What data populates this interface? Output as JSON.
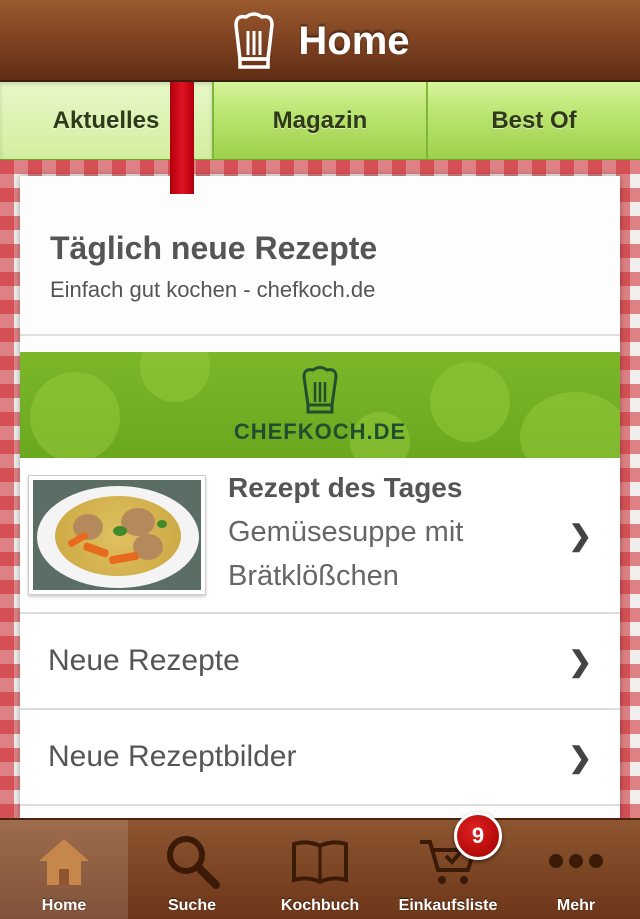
{
  "header": {
    "title": "Home"
  },
  "tabs": [
    {
      "label": "Aktuelles",
      "active": true
    },
    {
      "label": "Magazin",
      "active": false
    },
    {
      "label": "Best Of",
      "active": false
    }
  ],
  "intro": {
    "title": "Täglich neue Rezepte",
    "subtitle": "Einfach gut kochen - chefkoch.de"
  },
  "banner": {
    "logo_text": "CHEFKOCH.DE"
  },
  "featured": {
    "title": "Rezept des Tages",
    "line1": "Gemüsesuppe mit",
    "line2": "Brätklößchen"
  },
  "list": [
    {
      "label": "Neue Rezepte"
    },
    {
      "label": "Neue Rezeptbilder"
    }
  ],
  "tabbar": {
    "items": [
      {
        "label": "Home",
        "icon": "home-icon",
        "active": true
      },
      {
        "label": "Suche",
        "icon": "search-icon",
        "active": false
      },
      {
        "label": "Kochbuch",
        "icon": "book-icon",
        "active": false
      },
      {
        "label": "Einkaufsliste",
        "icon": "cart-icon",
        "active": false
      },
      {
        "label": "Mehr",
        "icon": "more-icon",
        "active": false
      }
    ],
    "badge": "9"
  },
  "colors": {
    "header_brown": "#7b4020",
    "tab_green": "#b8e36d",
    "ribbon_red": "#e01222",
    "banner_green": "#6aa81e",
    "badge_red": "#c00000"
  }
}
